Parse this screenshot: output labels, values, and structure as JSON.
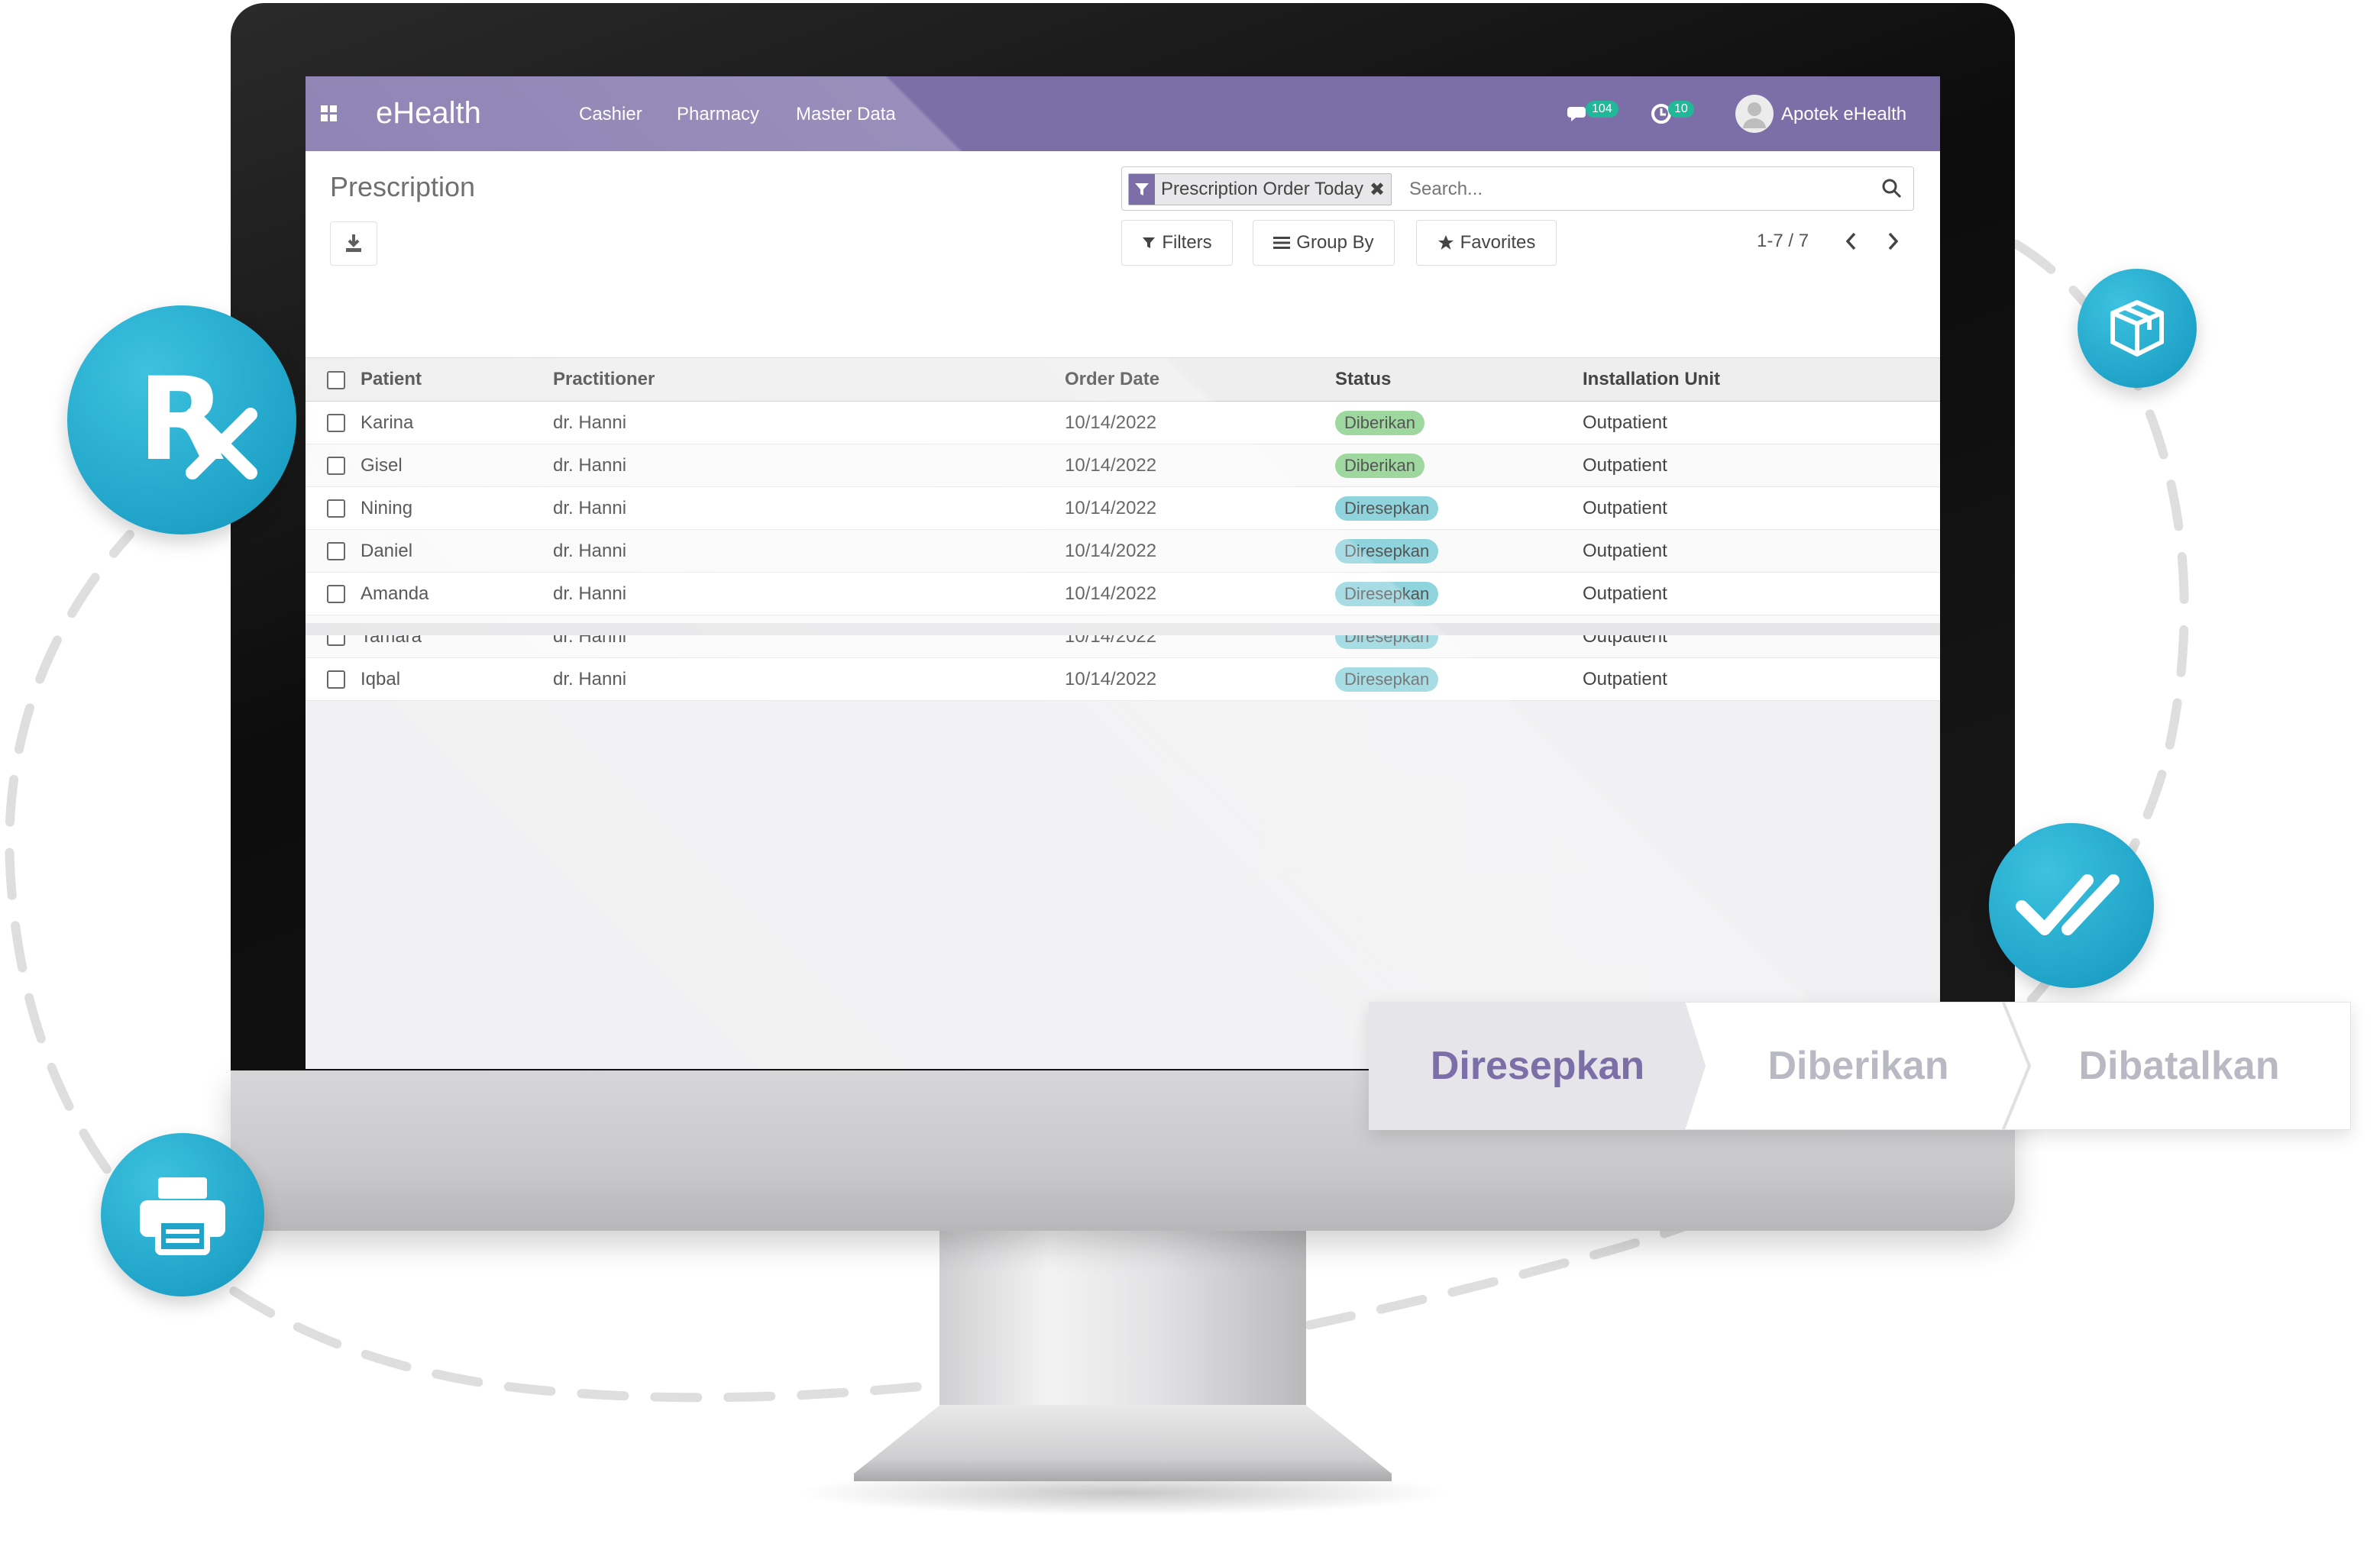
{
  "app": {
    "brand": "eHealth",
    "nav": [
      "Cashier",
      "Pharmacy",
      "Master Data"
    ],
    "messages_count": "104",
    "activities_count": "10",
    "user_name": "Apotek eHealth"
  },
  "page": {
    "title": "Prescription"
  },
  "search": {
    "facet_label": "Prescription Order Today",
    "placeholder": "Search..."
  },
  "toolbar": {
    "filters_label": "Filters",
    "groupby_label": "Group By",
    "favorites_label": "Favorites",
    "pager": "1-7 / 7"
  },
  "table": {
    "columns": [
      "Patient",
      "Practitioner",
      "Order Date",
      "Status",
      "Installation Unit"
    ],
    "rows": [
      {
        "patient": "Karina",
        "practitioner": "dr. Hanni",
        "order_date": "10/14/2022",
        "status": "Diberikan",
        "unit": "Outpatient"
      },
      {
        "patient": "Gisel",
        "practitioner": "dr. Hanni",
        "order_date": "10/14/2022",
        "status": "Diberikan",
        "unit": "Outpatient"
      },
      {
        "patient": "Nining",
        "practitioner": "dr. Hanni",
        "order_date": "10/14/2022",
        "status": "Diresepkan",
        "unit": "Outpatient"
      },
      {
        "patient": "Daniel",
        "practitioner": "dr. Hanni",
        "order_date": "10/14/2022",
        "status": "Diresepkan",
        "unit": "Outpatient"
      },
      {
        "patient": "Amanda",
        "practitioner": "dr. Hanni",
        "order_date": "10/14/2022",
        "status": "Diresepkan",
        "unit": "Outpatient"
      },
      {
        "patient": "Tamara",
        "practitioner": "dr. Hanni",
        "order_date": "10/14/2022",
        "status": "Diresepkan",
        "unit": "Outpatient"
      },
      {
        "patient": "Iqbal",
        "practitioner": "dr. Hanni",
        "order_date": "10/14/2022",
        "status": "Diresepkan",
        "unit": "Outpatient"
      }
    ]
  },
  "pipeline": {
    "stages": [
      "Diresepkan",
      "Diberikan",
      "Dibatalkan"
    ],
    "active_stage": "Diresepkan"
  },
  "decor": {
    "rx_symbol": "R",
    "icons": [
      "rx-icon",
      "cube-icon",
      "double-check-icon",
      "printer-icon"
    ]
  },
  "colors": {
    "topbar": "#7c6fa8",
    "accent_circle": "#1fa3c8",
    "status_given": "#9ed89e",
    "status_prescribed": "#8fd3dd",
    "badge": "#21b799"
  }
}
